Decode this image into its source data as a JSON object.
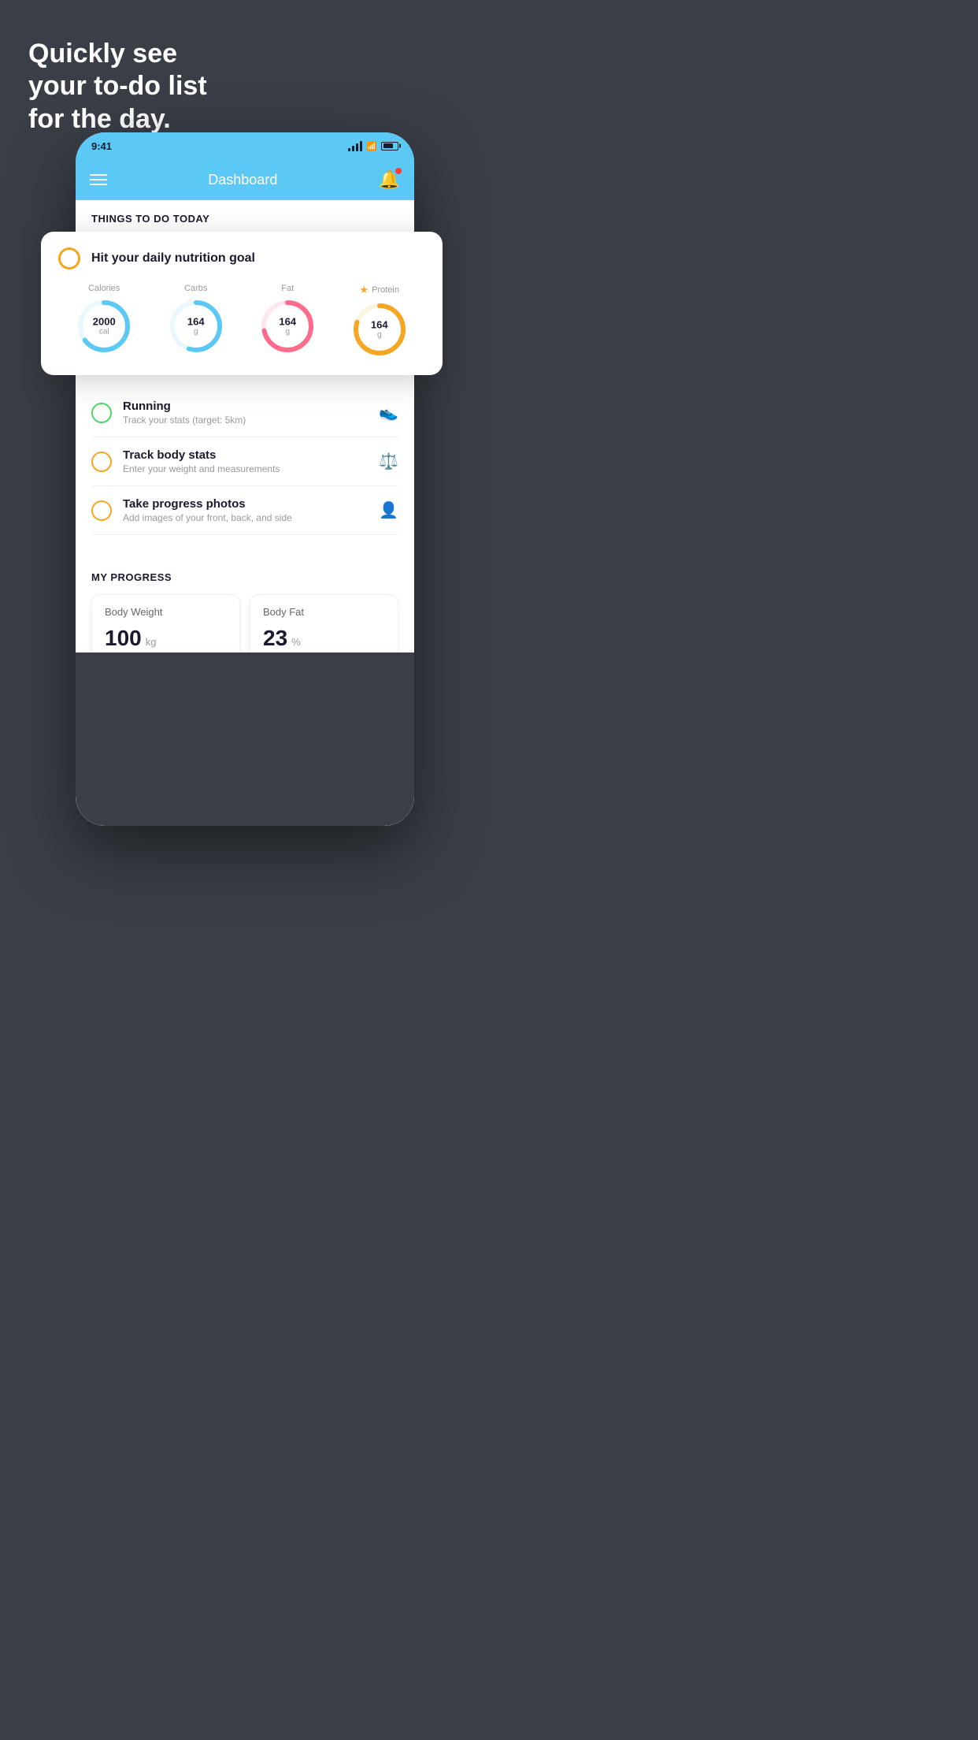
{
  "hero": {
    "line1": "Quickly see",
    "line2": "your to-do list",
    "line3": "for the day."
  },
  "phone": {
    "statusBar": {
      "time": "9:41"
    },
    "header": {
      "title": "Dashboard"
    },
    "thingsToDoSection": "THINGS TO DO TODAY",
    "nutritionCard": {
      "title": "Hit your daily nutrition goal",
      "stats": [
        {
          "label": "Calories",
          "value": "2000",
          "unit": "cal",
          "color": "#5bc8f5",
          "progress": 65,
          "star": false
        },
        {
          "label": "Carbs",
          "value": "164",
          "unit": "g",
          "color": "#5bc8f5",
          "progress": 55,
          "star": false
        },
        {
          "label": "Fat",
          "value": "164",
          "unit": "g",
          "color": "#ff6b8a",
          "progress": 72,
          "star": false
        },
        {
          "label": "Protein",
          "value": "164",
          "unit": "g",
          "color": "#f5a623",
          "progress": 80,
          "star": true
        }
      ]
    },
    "todoItems": [
      {
        "title": "Running",
        "subtitle": "Track your stats (target: 5km)",
        "circleColor": "green",
        "icon": "👟"
      },
      {
        "title": "Track body stats",
        "subtitle": "Enter your weight and measurements",
        "circleColor": "yellow",
        "icon": "⚖️"
      },
      {
        "title": "Take progress photos",
        "subtitle": "Add images of your front, back, and side",
        "circleColor": "yellow",
        "icon": "👤"
      }
    ],
    "progressSection": {
      "title": "MY PROGRESS",
      "cards": [
        {
          "title": "Body Weight",
          "value": "100",
          "unit": "kg"
        },
        {
          "title": "Body Fat",
          "value": "23",
          "unit": "%"
        }
      ]
    }
  }
}
